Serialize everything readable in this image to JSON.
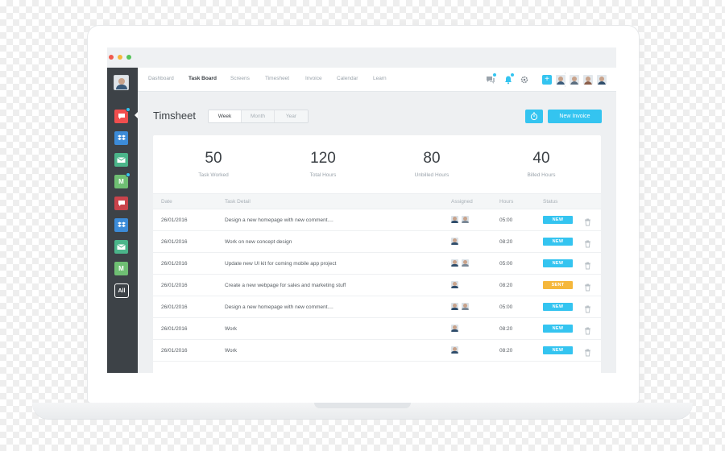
{
  "sidebar": {
    "apps": [
      {
        "icon": "chat-app-icon",
        "color": "#f04e4e",
        "label": "",
        "badge": true
      },
      {
        "icon": "dropbox-app-icon",
        "color": "#3c8bd8",
        "label": "",
        "badge": false
      },
      {
        "icon": "gmail-app-icon",
        "color": "#4bb58a",
        "label": "",
        "badge": false
      },
      {
        "icon": "m-app-icon",
        "color": "#6fbf73",
        "label": "M",
        "badge": true
      },
      {
        "icon": "chat-app-icon",
        "color": "#c9434b",
        "label": "",
        "badge": false
      },
      {
        "icon": "dropbox-app-icon",
        "color": "#3c8bd8",
        "label": "",
        "badge": false
      },
      {
        "icon": "gmail-app-icon",
        "color": "#4bb58a",
        "label": "",
        "badge": false
      },
      {
        "icon": "m-app-icon",
        "color": "#6fbf73",
        "label": "M",
        "badge": false
      }
    ],
    "all_label": "All"
  },
  "nav": {
    "items": [
      "Dashboard",
      "Task Board",
      "Screens",
      "Timesheet",
      "Invoice",
      "Calendar",
      "Learn"
    ],
    "active": "Task Board"
  },
  "header": {
    "title": "Timsheet",
    "tabs": [
      "Week",
      "Month",
      "Year"
    ],
    "active_tab": "Week",
    "new_invoice_label": "New Invoice"
  },
  "stats": [
    {
      "value": "50",
      "label": "Task Worked"
    },
    {
      "value": "120",
      "label": "Total Hours"
    },
    {
      "value": "80",
      "label": "Unbilled Hours"
    },
    {
      "value": "40",
      "label": "Billed Hours"
    }
  ],
  "table": {
    "columns": [
      "Date",
      "Task Detail",
      "Assigned",
      "Hours",
      "Status"
    ],
    "rows": [
      {
        "date": "26/01/2016",
        "task": "Design a new homepage with new comment....",
        "assigned": 2,
        "hours": "05:00",
        "status": "NEW"
      },
      {
        "date": "26/01/2016",
        "task": "Work on new concept design",
        "assigned": 1,
        "hours": "08:20",
        "status": "NEW"
      },
      {
        "date": "26/01/2016",
        "task": "Update new UI kit for coming mobile app project",
        "assigned": 2,
        "hours": "05:00",
        "status": "NEW"
      },
      {
        "date": "26/01/2016",
        "task": "Create a new webpage for sales and marketing stuff",
        "assigned": 1,
        "hours": "08:20",
        "status": "SENT"
      },
      {
        "date": "26/01/2016",
        "task": "Design a new homepage with new comment....",
        "assigned": 2,
        "hours": "05:00",
        "status": "NEW"
      },
      {
        "date": "26/01/2016",
        "task": "Work",
        "assigned": 1,
        "hours": "08:20",
        "status": "NEW"
      },
      {
        "date": "26/01/2016",
        "task": "Work",
        "assigned": 1,
        "hours": "08:20",
        "status": "NEW"
      }
    ]
  },
  "colors": {
    "accent": "#34c4f0",
    "status_new": "#34c4f0",
    "status_sent": "#f5b73b",
    "sidebar": "#3d4247"
  }
}
